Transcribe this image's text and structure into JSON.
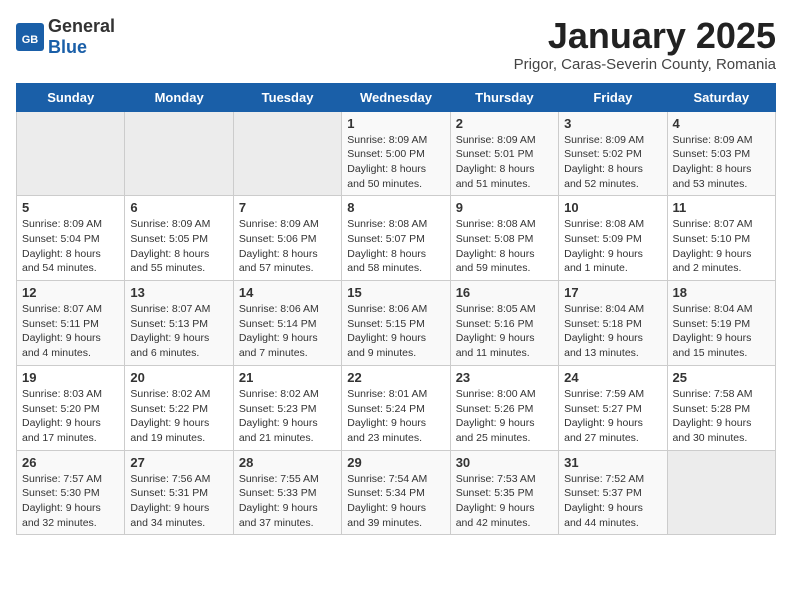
{
  "header": {
    "logo_general": "General",
    "logo_blue": "Blue",
    "title": "January 2025",
    "subtitle": "Prigor, Caras-Severin County, Romania"
  },
  "weekdays": [
    "Sunday",
    "Monday",
    "Tuesday",
    "Wednesday",
    "Thursday",
    "Friday",
    "Saturday"
  ],
  "weeks": [
    [
      {
        "day": "",
        "info": ""
      },
      {
        "day": "",
        "info": ""
      },
      {
        "day": "",
        "info": ""
      },
      {
        "day": "1",
        "info": "Sunrise: 8:09 AM\nSunset: 5:00 PM\nDaylight: 8 hours\nand 50 minutes."
      },
      {
        "day": "2",
        "info": "Sunrise: 8:09 AM\nSunset: 5:01 PM\nDaylight: 8 hours\nand 51 minutes."
      },
      {
        "day": "3",
        "info": "Sunrise: 8:09 AM\nSunset: 5:02 PM\nDaylight: 8 hours\nand 52 minutes."
      },
      {
        "day": "4",
        "info": "Sunrise: 8:09 AM\nSunset: 5:03 PM\nDaylight: 8 hours\nand 53 minutes."
      }
    ],
    [
      {
        "day": "5",
        "info": "Sunrise: 8:09 AM\nSunset: 5:04 PM\nDaylight: 8 hours\nand 54 minutes."
      },
      {
        "day": "6",
        "info": "Sunrise: 8:09 AM\nSunset: 5:05 PM\nDaylight: 8 hours\nand 55 minutes."
      },
      {
        "day": "7",
        "info": "Sunrise: 8:09 AM\nSunset: 5:06 PM\nDaylight: 8 hours\nand 57 minutes."
      },
      {
        "day": "8",
        "info": "Sunrise: 8:08 AM\nSunset: 5:07 PM\nDaylight: 8 hours\nand 58 minutes."
      },
      {
        "day": "9",
        "info": "Sunrise: 8:08 AM\nSunset: 5:08 PM\nDaylight: 8 hours\nand 59 minutes."
      },
      {
        "day": "10",
        "info": "Sunrise: 8:08 AM\nSunset: 5:09 PM\nDaylight: 9 hours\nand 1 minute."
      },
      {
        "day": "11",
        "info": "Sunrise: 8:07 AM\nSunset: 5:10 PM\nDaylight: 9 hours\nand 2 minutes."
      }
    ],
    [
      {
        "day": "12",
        "info": "Sunrise: 8:07 AM\nSunset: 5:11 PM\nDaylight: 9 hours\nand 4 minutes."
      },
      {
        "day": "13",
        "info": "Sunrise: 8:07 AM\nSunset: 5:13 PM\nDaylight: 9 hours\nand 6 minutes."
      },
      {
        "day": "14",
        "info": "Sunrise: 8:06 AM\nSunset: 5:14 PM\nDaylight: 9 hours\nand 7 minutes."
      },
      {
        "day": "15",
        "info": "Sunrise: 8:06 AM\nSunset: 5:15 PM\nDaylight: 9 hours\nand 9 minutes."
      },
      {
        "day": "16",
        "info": "Sunrise: 8:05 AM\nSunset: 5:16 PM\nDaylight: 9 hours\nand 11 minutes."
      },
      {
        "day": "17",
        "info": "Sunrise: 8:04 AM\nSunset: 5:18 PM\nDaylight: 9 hours\nand 13 minutes."
      },
      {
        "day": "18",
        "info": "Sunrise: 8:04 AM\nSunset: 5:19 PM\nDaylight: 9 hours\nand 15 minutes."
      }
    ],
    [
      {
        "day": "19",
        "info": "Sunrise: 8:03 AM\nSunset: 5:20 PM\nDaylight: 9 hours\nand 17 minutes."
      },
      {
        "day": "20",
        "info": "Sunrise: 8:02 AM\nSunset: 5:22 PM\nDaylight: 9 hours\nand 19 minutes."
      },
      {
        "day": "21",
        "info": "Sunrise: 8:02 AM\nSunset: 5:23 PM\nDaylight: 9 hours\nand 21 minutes."
      },
      {
        "day": "22",
        "info": "Sunrise: 8:01 AM\nSunset: 5:24 PM\nDaylight: 9 hours\nand 23 minutes."
      },
      {
        "day": "23",
        "info": "Sunrise: 8:00 AM\nSunset: 5:26 PM\nDaylight: 9 hours\nand 25 minutes."
      },
      {
        "day": "24",
        "info": "Sunrise: 7:59 AM\nSunset: 5:27 PM\nDaylight: 9 hours\nand 27 minutes."
      },
      {
        "day": "25",
        "info": "Sunrise: 7:58 AM\nSunset: 5:28 PM\nDaylight: 9 hours\nand 30 minutes."
      }
    ],
    [
      {
        "day": "26",
        "info": "Sunrise: 7:57 AM\nSunset: 5:30 PM\nDaylight: 9 hours\nand 32 minutes."
      },
      {
        "day": "27",
        "info": "Sunrise: 7:56 AM\nSunset: 5:31 PM\nDaylight: 9 hours\nand 34 minutes."
      },
      {
        "day": "28",
        "info": "Sunrise: 7:55 AM\nSunset: 5:33 PM\nDaylight: 9 hours\nand 37 minutes."
      },
      {
        "day": "29",
        "info": "Sunrise: 7:54 AM\nSunset: 5:34 PM\nDaylight: 9 hours\nand 39 minutes."
      },
      {
        "day": "30",
        "info": "Sunrise: 7:53 AM\nSunset: 5:35 PM\nDaylight: 9 hours\nand 42 minutes."
      },
      {
        "day": "31",
        "info": "Sunrise: 7:52 AM\nSunset: 5:37 PM\nDaylight: 9 hours\nand 44 minutes."
      },
      {
        "day": "",
        "info": ""
      }
    ]
  ]
}
